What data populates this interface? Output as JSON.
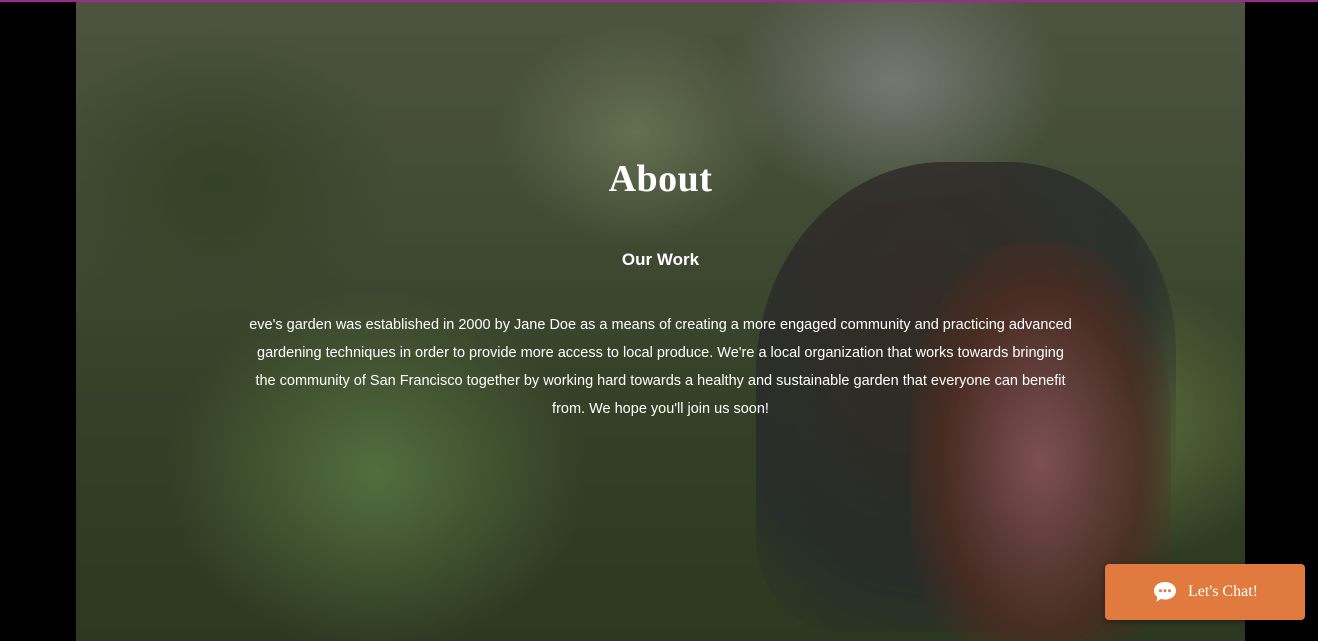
{
  "hero": {
    "title": "About",
    "subtitle": "Our Work",
    "body": "eve's garden was established in 2000 by Jane Doe as a means of creating a more engaged community and practicing advanced gardening techniques in order to provide more access to local produce. We're a local organization that works towards bringing the community of San Francisco together by working hard towards a healthy and sustainable garden that everyone can benefit from. We hope you'll join us soon!",
    "background_image": "woman-and-girl-gardening-photo"
  },
  "chat_widget": {
    "label": "Let's Chat!",
    "icon": "chat-bubble-icon",
    "color": "#e07a3e"
  },
  "colors": {
    "accent_top_line": "#9b2a8a",
    "text": "#ffffff"
  }
}
